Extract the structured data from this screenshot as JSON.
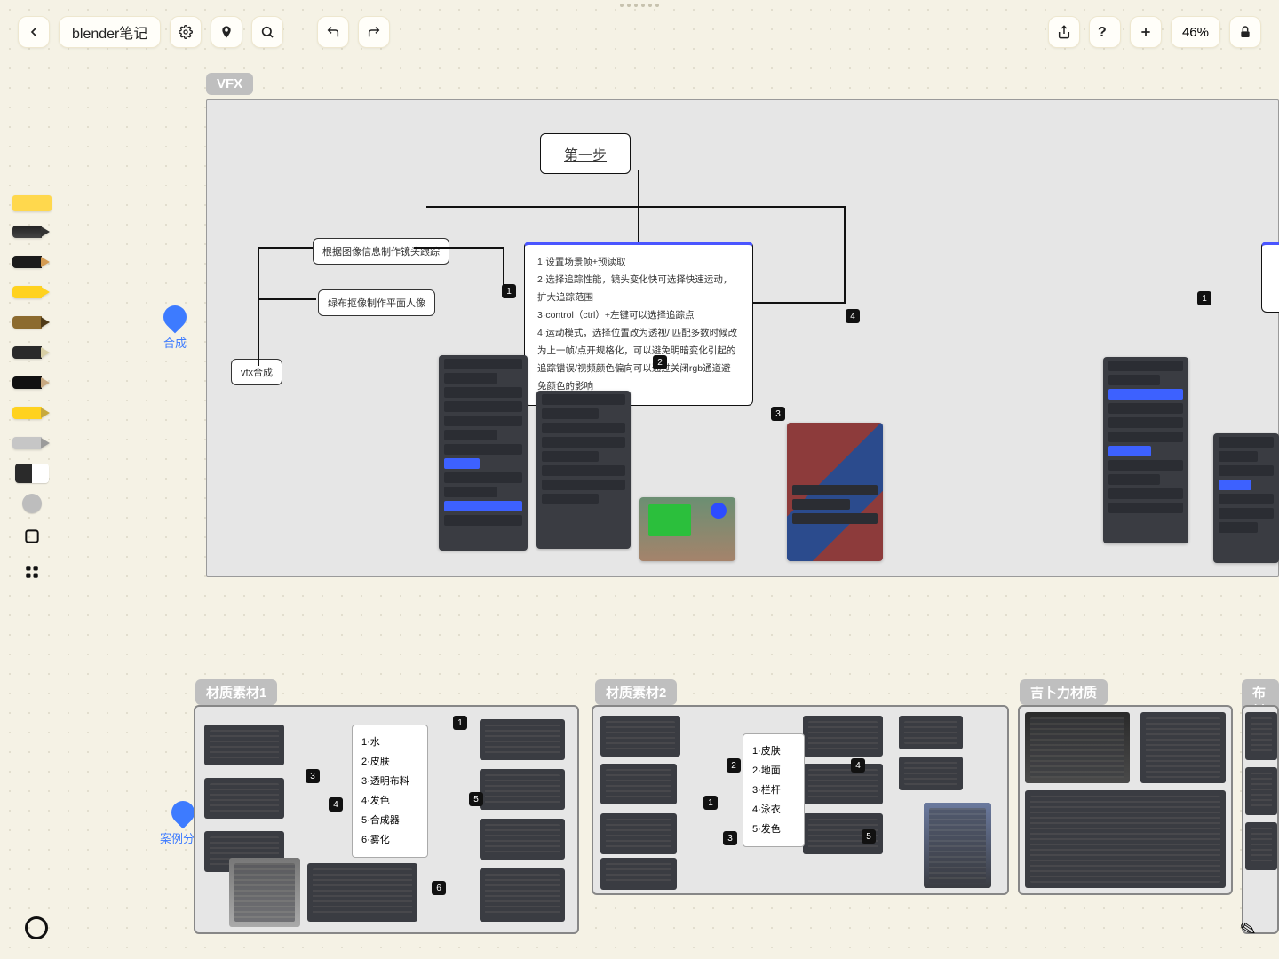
{
  "topbar": {
    "title": "blender笔记",
    "zoom": "46%"
  },
  "anchors": {
    "a1": "合成",
    "a2": "案例分解"
  },
  "frame_tags": {
    "vfx": "VFX",
    "mat1": "材质素材1",
    "mat2": "材质素材2",
    "ghibli": "吉卜力材质",
    "cloth": "布料"
  },
  "vfx": {
    "step_title": "第一步",
    "card_track": "根据图像信息制作镜头跟踪",
    "card_green": "绿布抠像制作平面人像",
    "card_comp": "vfx合成",
    "note_l1": "1·设置场景帧+预读取",
    "note_l2": "2·选择追踪性能，镜头变化快可选择快速运动，扩大追踪范围",
    "note_l3": "3·control（ctrl）+左键可以选择追踪点",
    "note_l4": "4·运动模式，选择位置改为透视/ 匹配多数时候改为上一帧/点开规格化，可以避免明暗变化引起的追踪错误/视频颜色偏向可以通过关闭rgb通道避免颜色的影响"
  },
  "mat1_list": {
    "i1": "1·水",
    "i2": "2·皮肤",
    "i3": "3·透明布料",
    "i4": "4·发色",
    "i5": "5·合成器",
    "i6": "6·雾化"
  },
  "mat2_list": {
    "i1": "1·皮肤",
    "i2": "2·地面",
    "i3": "3·栏杆",
    "i4": "4·泳衣",
    "i5": "5·发色"
  },
  "nums": {
    "n1": "1",
    "n2": "2",
    "n3": "3",
    "n4": "4",
    "n5": "5",
    "n6": "6"
  }
}
